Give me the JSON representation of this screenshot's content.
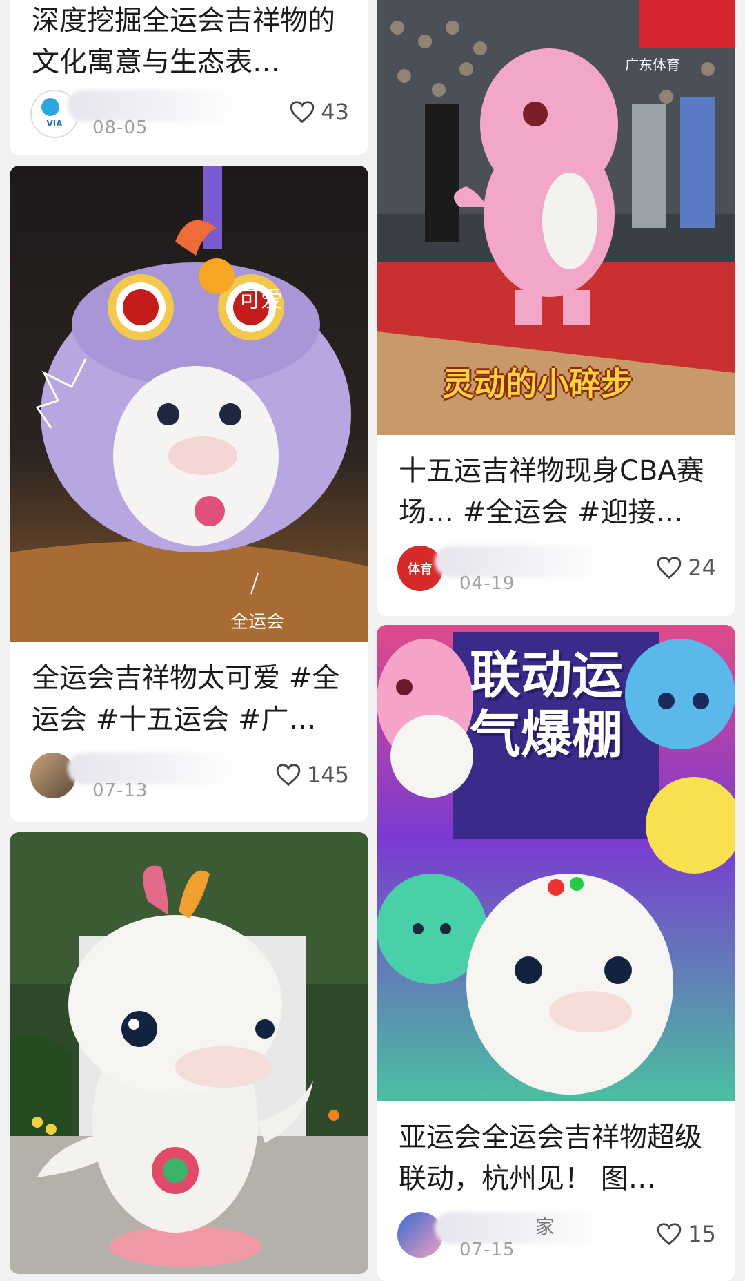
{
  "feed": {
    "cards": [
      {
        "title": "深度挖掘全运会吉祥物的文化寓意与生态表…",
        "date": "08-05",
        "likes": "43",
        "avatar_text": "VIA"
      },
      {
        "title": "全运会吉祥物太可爱 #全运会 #十五运会 #广…",
        "date": "07-13",
        "likes": "145",
        "image_caption": "可爱",
        "image_caption2": "全运会"
      },
      {
        "image": "dolphin-mascot-statue"
      },
      {
        "title": "十五运吉祥物现身CBA赛场… #全运会  #迎接…",
        "date": "04-19",
        "likes": "24",
        "image_caption": "灵动的小碎步",
        "avatar_text": "体育",
        "watermark": "广东体育"
      },
      {
        "title": "亚运会全运会吉祥物超级联动，杭州见！ 图…",
        "date": "07-15",
        "likes": "15",
        "author_suffix": "家",
        "image_caption": "联动运气爆棚"
      }
    ]
  },
  "icons": {
    "like": "heart-outline-icon"
  },
  "colors": {
    "background": "#f1f1f1",
    "card": "#ffffff",
    "text": "#1a1a1a",
    "muted": "#a0a0a0"
  }
}
